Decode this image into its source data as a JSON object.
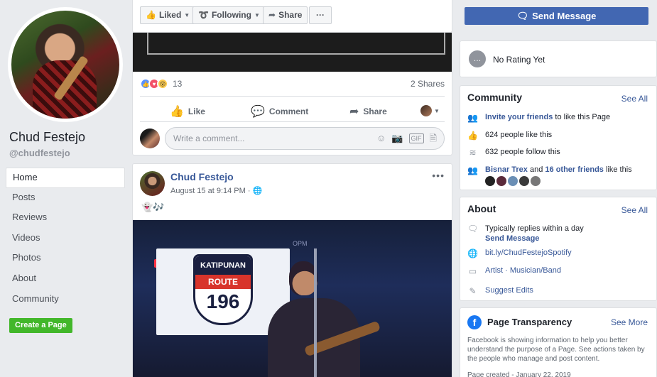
{
  "page": {
    "name": "Chud Festejo",
    "handle": "@chudfestejo"
  },
  "nav": {
    "items": [
      {
        "label": "Home"
      },
      {
        "label": "Posts"
      },
      {
        "label": "Reviews"
      },
      {
        "label": "Videos"
      },
      {
        "label": "Photos"
      },
      {
        "label": "About"
      },
      {
        "label": "Community"
      }
    ],
    "create_page": "Create a Page"
  },
  "action_bar": {
    "liked": "Liked",
    "following": "Following",
    "share": "Share",
    "more": "···"
  },
  "post1": {
    "reaction_count": "13",
    "shares": "2 Shares",
    "like": "Like",
    "comment": "Comment",
    "share": "Share",
    "comment_placeholder": "Write a comment..."
  },
  "post2": {
    "author": "Chud Festejo",
    "time": "August 15 at 9:14 PM",
    "privacy_sep": "·",
    "text": "👻🎶",
    "image": {
      "banner_top": "KATIPUNAN",
      "banner_mid": "ROUTE",
      "banner_num": "196",
      "corner_text": "OPM"
    }
  },
  "sidebar": {
    "send_message": "Send Message",
    "rating": "No Rating Yet",
    "community": {
      "title": "Community",
      "see_all": "See All",
      "invite_link": "Invite your friends",
      "invite_rest": "to like this Page",
      "likes": "624 people like this",
      "follows": "632 people follow this",
      "friend_name": "Bisnar Trex",
      "friend_and": "and",
      "friend_others": "16 other friends",
      "friend_rest": "like this"
    },
    "about": {
      "title": "About",
      "see_all": "See All",
      "reply": "Typically replies within a day",
      "send_message": "Send Message",
      "link": "bit.ly/ChudFestejoSpotify",
      "category": "Artist · Musician/Band",
      "suggest": "Suggest Edits"
    },
    "transparency": {
      "title": "Page Transparency",
      "see_more": "See More",
      "description": "Facebook is showing information to help you better understand the purpose of a Page. See actions taken by the people who manage and post content.",
      "created": "Page created - January 22, 2019"
    }
  },
  "colors": {
    "brand_blue": "#4267b2",
    "link_blue": "#385898",
    "create_green": "#42b72a",
    "page_bg": "#e9ebee"
  }
}
